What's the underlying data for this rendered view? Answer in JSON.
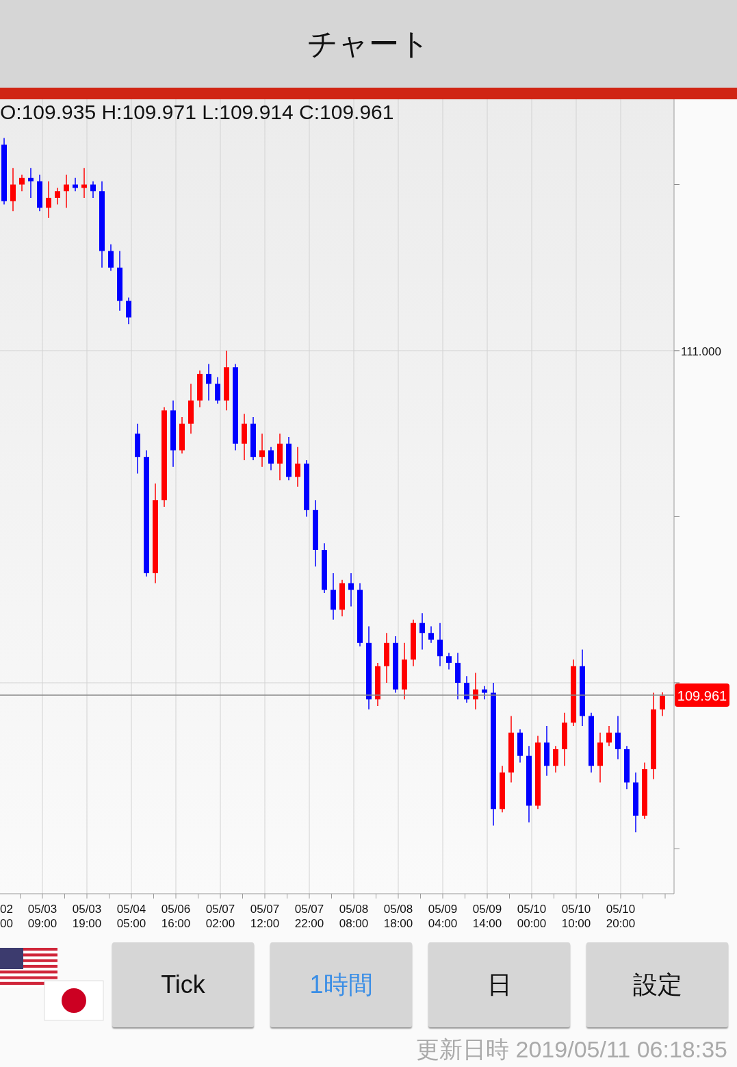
{
  "header": {
    "title": "チャート"
  },
  "chart": {
    "ohlc": "O:109.935 H:109.971 L:109.914 C:109.961",
    "y_labels": [
      "111.000"
    ],
    "current_price": "109.961",
    "x_labels": [
      {
        "date": "02",
        "time": "00"
      },
      {
        "date": "05/03",
        "time": "09:00"
      },
      {
        "date": "05/03",
        "time": "19:00"
      },
      {
        "date": "05/04",
        "time": "05:00"
      },
      {
        "date": "05/06",
        "time": "16:00"
      },
      {
        "date": "05/07",
        "time": "02:00"
      },
      {
        "date": "05/07",
        "time": "12:00"
      },
      {
        "date": "05/07",
        "time": "22:00"
      },
      {
        "date": "05/08",
        "time": "08:00"
      },
      {
        "date": "05/08",
        "time": "18:00"
      },
      {
        "date": "05/09",
        "time": "04:00"
      },
      {
        "date": "05/09",
        "time": "14:00"
      },
      {
        "date": "05/10",
        "time": "00:00"
      },
      {
        "date": "05/10",
        "time": "10:00"
      },
      {
        "date": "05/10",
        "time": "20:00"
      }
    ]
  },
  "buttons": [
    {
      "label": "Tick",
      "selected": false
    },
    {
      "label": "1時間",
      "selected": true
    },
    {
      "label": "日",
      "selected": false
    },
    {
      "label": "設定",
      "selected": false
    }
  ],
  "updated": "更新日時 2019/05/11 06:18:35"
}
